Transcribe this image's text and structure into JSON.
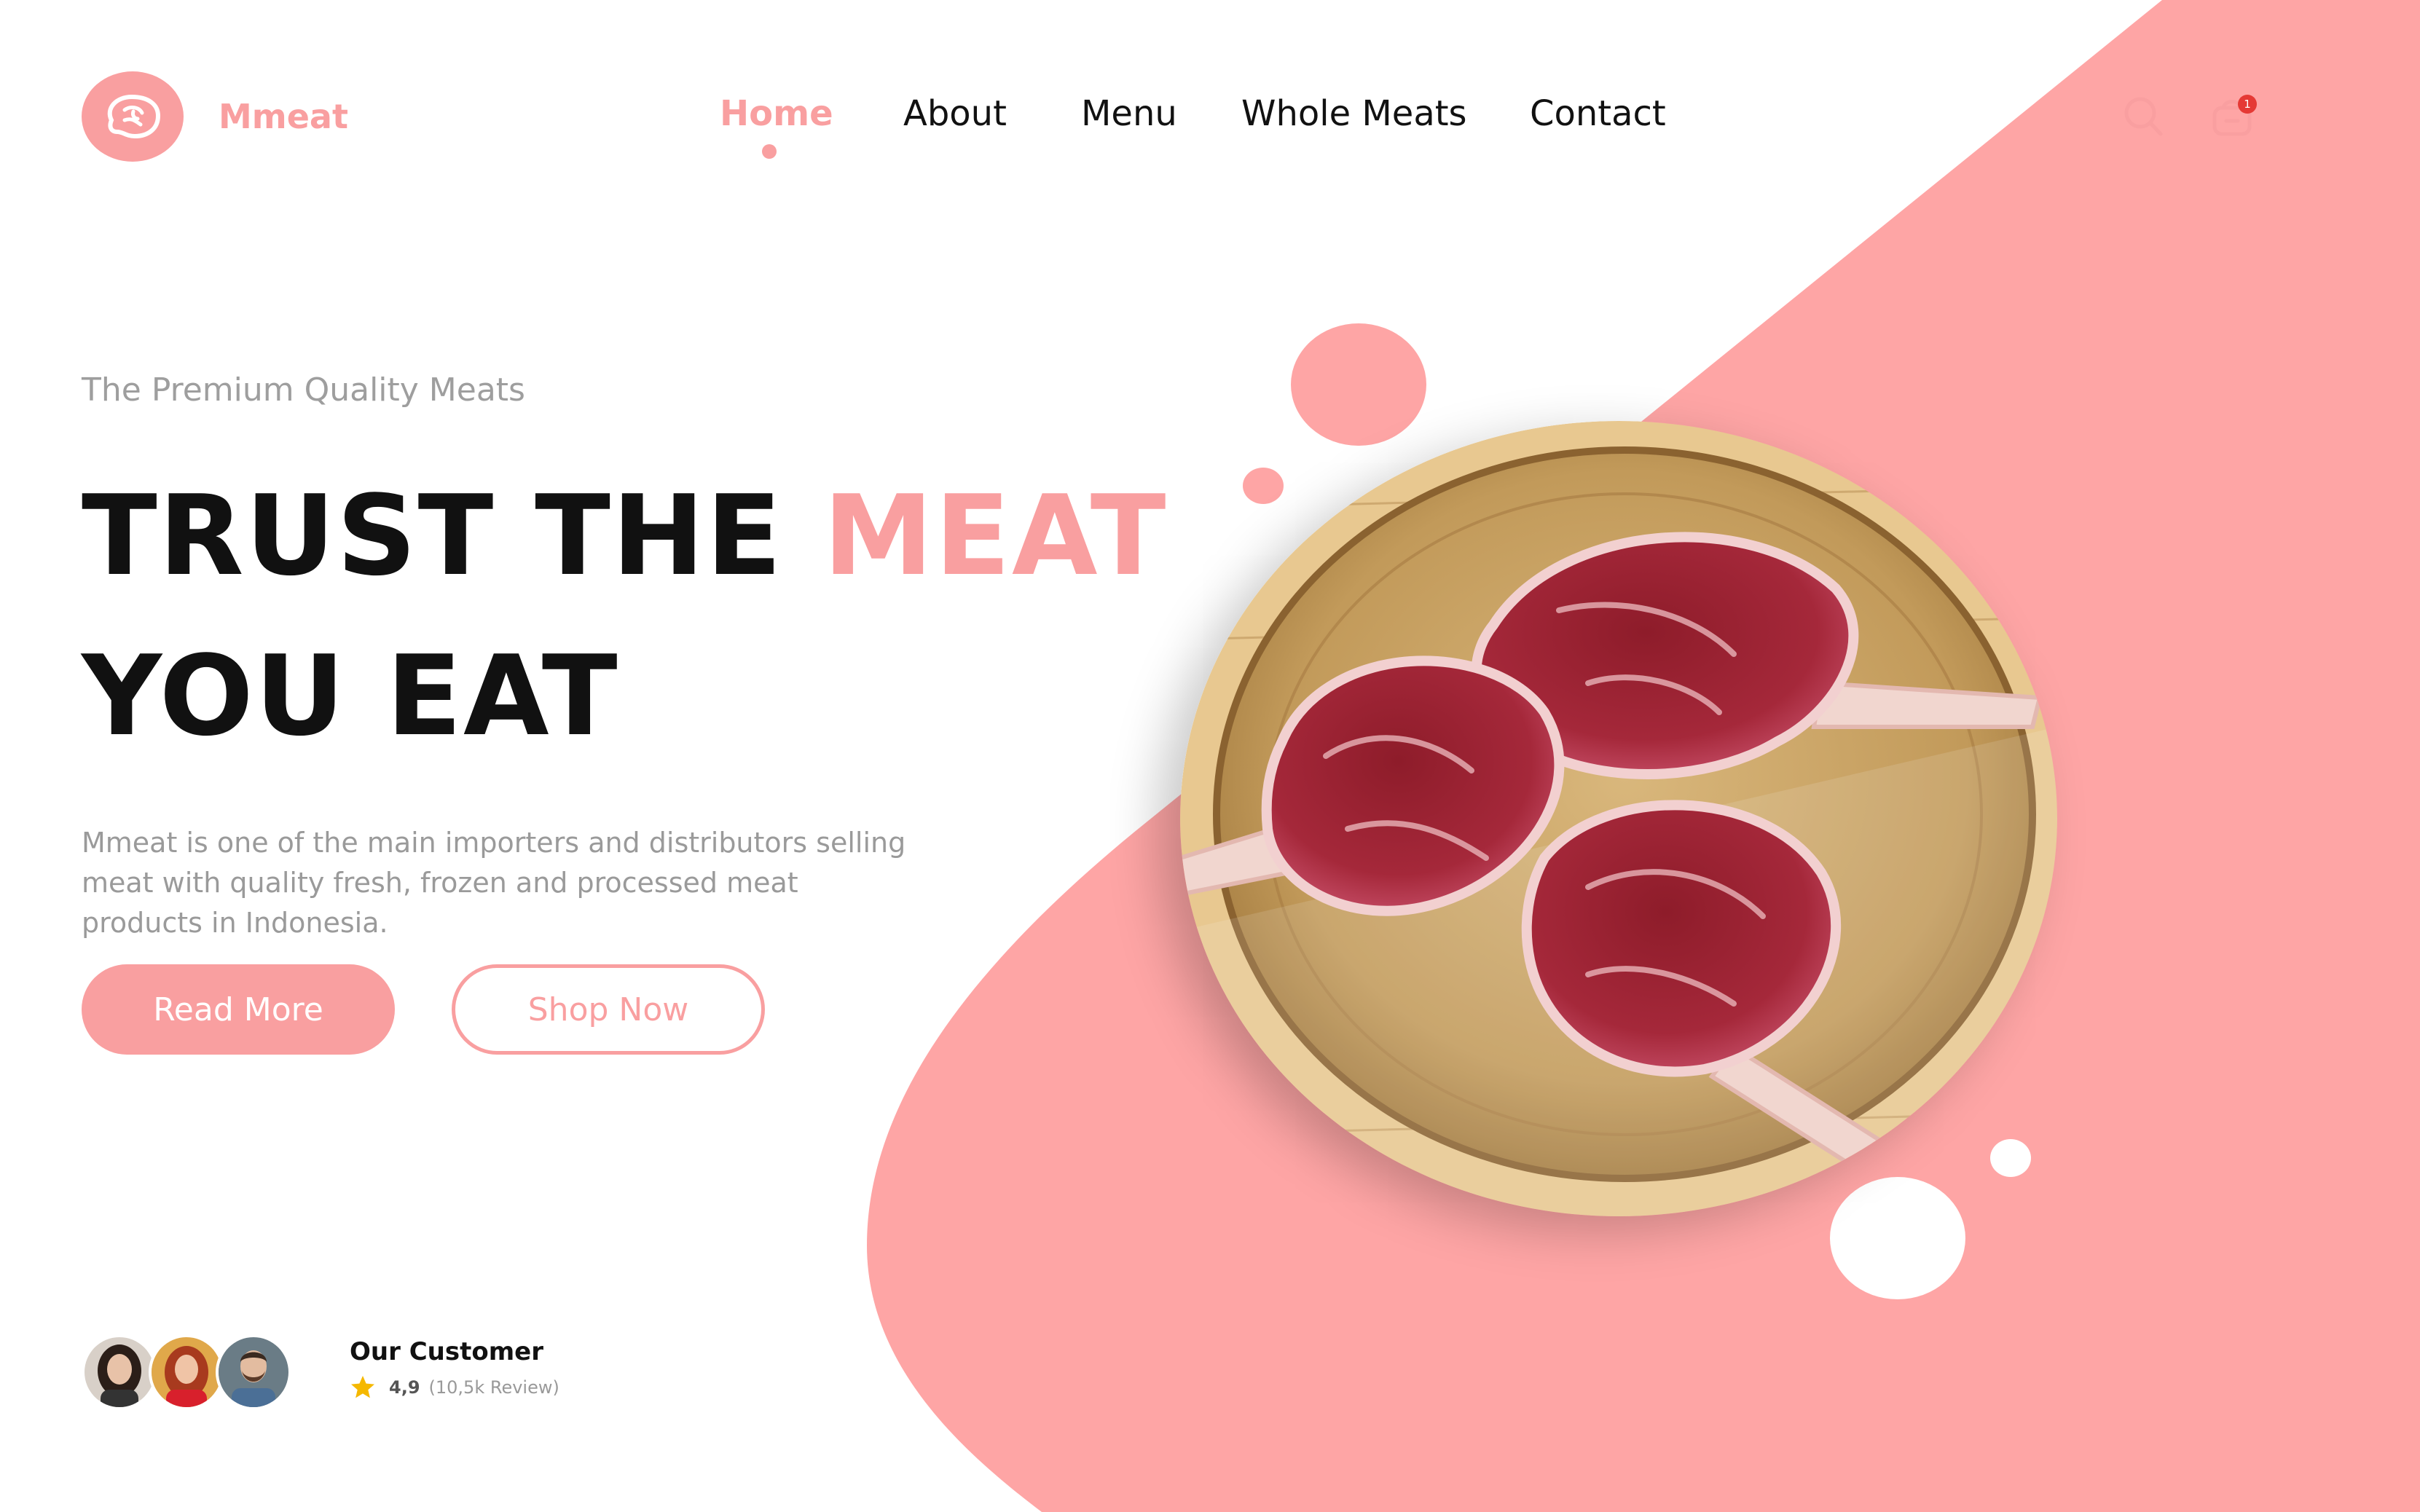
{
  "brand": {
    "name": "Mmeat",
    "logo_icon": "meat-icon",
    "accent_color": "#f99fa0"
  },
  "nav": {
    "items": [
      {
        "label": "Home",
        "active": true
      },
      {
        "label": "About",
        "active": false
      },
      {
        "label": "Menu",
        "active": false
      },
      {
        "label": "Whole Meats",
        "active": false
      },
      {
        "label": "Contact",
        "active": false
      }
    ]
  },
  "header_icons": {
    "search_icon": "search-icon",
    "cart_icon": "shopping-bag-icon",
    "cart_count": "1"
  },
  "hero": {
    "tagline": "The Premium Quality Meats",
    "headline_line1_part1": "TRUST THE ",
    "headline_line1_accent": "MEAT",
    "headline_line2": "YOU EAT",
    "description": "Mmeat is one of the main importers and distributors selling meat  with quality fresh, frozen and processed meat products in Indonesia.",
    "buttons": {
      "primary": "Read More",
      "secondary": "Shop Now"
    },
    "image_icon": "meat-plate-image"
  },
  "customers": {
    "title": "Our Customer",
    "rating": "4,9",
    "review_count": "(10,5k Review)",
    "star_color": "#f5b800",
    "avatars": [
      "avatar-woman-dark-hair",
      "avatar-woman-red-hair",
      "avatar-man-beard"
    ]
  }
}
